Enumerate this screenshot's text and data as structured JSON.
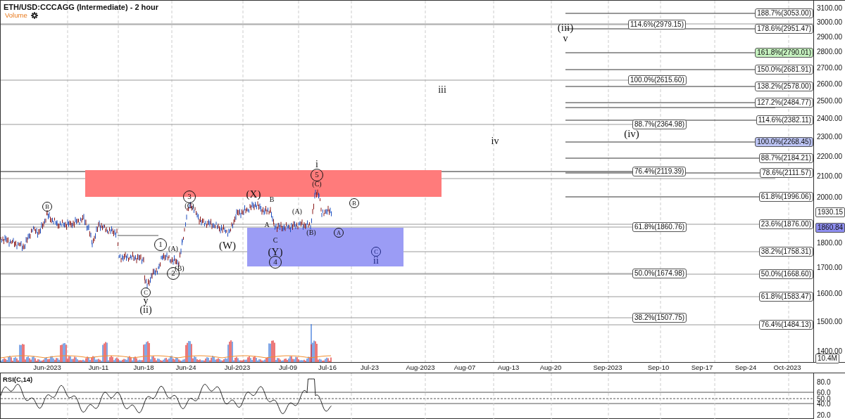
{
  "chart": {
    "title": "ETH/USD:CCCAGG (Intermediate) - 2 hour",
    "indicator": "Volume"
  },
  "price_axis": {
    "ticks": [
      "3100.00",
      "3000.00",
      "2900.00",
      "2800.00",
      "2700.00",
      "2600.00",
      "2500.00",
      "2400.00",
      "2300.00",
      "2200.00",
      "2100.00",
      "2000.00",
      "1800.00",
      "1700.00",
      "1600.00",
      "1500.00",
      "1400.00"
    ],
    "price_tags": [
      {
        "label": "1930.15",
        "color": "#ffffff"
      },
      {
        "label": "1860.84",
        "color": "#8e8ef0"
      }
    ],
    "volume_tag": "10.4M"
  },
  "time_axis": {
    "labels": [
      "Jun-2023",
      "Jun-11",
      "Jun-18",
      "Jun-24",
      "Jul-2023",
      "Jul-09",
      "Jul-16",
      "Jul-23",
      "Aug-2023",
      "Aug-07",
      "Aug-13",
      "Aug-20",
      "Sep-2023",
      "Sep-10",
      "Sep-17",
      "Sep-24",
      "Oct-2023"
    ]
  },
  "fib_levels_right": [
    {
      "label": "188.7%(3053.00)",
      "color": "#ffffff"
    },
    {
      "label": "178.6%(2951.47)",
      "color": "#ffffff"
    },
    {
      "label": "161.8%(2790.01)",
      "color": "#c6f2c0"
    },
    {
      "label": "150.0%(2681.91)",
      "color": "#ffffff"
    },
    {
      "label": "138.2%(2578.00)",
      "color": "#ffffff"
    },
    {
      "label": "127.2%(2484.77)",
      "color": "#ffffff"
    },
    {
      "label": "114.6%(2382.11)",
      "color": "#ffffff"
    },
    {
      "label": "100.0%(2268.45)",
      "color": "#bcc4f4"
    },
    {
      "label": "88.7%(2184.21)",
      "color": "#ffffff"
    },
    {
      "label": "78.6%(2111.57)",
      "color": "#ffffff"
    },
    {
      "label": "61.8%(1996.06)",
      "color": "#ffffff"
    },
    {
      "label": "23.6%(1876.00)",
      "color": "#ffffff"
    },
    {
      "label": "38.2%(1758.31)",
      "color": "#ffffff"
    },
    {
      "label": "50.0%(1668.60)",
      "color": "#ffffff"
    },
    {
      "label": "61.8%(1583.47)",
      "color": "#ffffff"
    },
    {
      "label": "76.4%(1484.13)",
      "color": "#ffffff"
    }
  ],
  "fib_levels_center": [
    {
      "label": "114.6%(2979.15)"
    },
    {
      "label": "100.0%(2615.60)"
    },
    {
      "label": "88.7%(2364.98)"
    },
    {
      "label": "76.4%(2119.39)"
    },
    {
      "label": "61.8%(1860.76)"
    },
    {
      "label": "50.0%(1674.98)"
    },
    {
      "label": "38.2%(1507.75)"
    }
  ],
  "wave_labels": [
    {
      "text": "B",
      "circled": true
    },
    {
      "text": "C",
      "circled": true
    },
    {
      "text": "y",
      "circled": false
    },
    {
      "text": "(ii)",
      "circled": false
    },
    {
      "text": "1",
      "circled": true
    },
    {
      "text": "(A)",
      "circled": false
    },
    {
      "text": "2",
      "circled": true
    },
    {
      "text": "(B)",
      "circled": false
    },
    {
      "text": "3",
      "circled": true
    },
    {
      "text": "(C)",
      "circled": false
    },
    {
      "text": "(W)",
      "circled": false
    },
    {
      "text": "(X)",
      "circled": false
    },
    {
      "text": "A",
      "circled": false
    },
    {
      "text": "B",
      "circled": false
    },
    {
      "text": "C",
      "circled": false
    },
    {
      "text": "(Y)",
      "circled": false
    },
    {
      "text": "4",
      "circled": true
    },
    {
      "text": "(A)",
      "circled": false
    },
    {
      "text": "(B)",
      "circled": false
    },
    {
      "text": "i",
      "circled": false
    },
    {
      "text": "5",
      "circled": true
    },
    {
      "text": "(C)",
      "circled": false
    },
    {
      "text": "A",
      "circled": true
    },
    {
      "text": "B",
      "circled": true
    },
    {
      "text": "C",
      "circled": true
    },
    {
      "text": "ii",
      "circled": false
    },
    {
      "text": "iii",
      "circled": false
    },
    {
      "text": "iv",
      "circled": false
    },
    {
      "text": "(iii)",
      "circled": false
    },
    {
      "text": "v",
      "circled": false
    },
    {
      "text": "(iv)",
      "circled": false
    }
  ],
  "rsi": {
    "title": "RSI(C,14)",
    "ticks": [
      "80.0",
      "60.0",
      "50.0",
      "40.0",
      "20.0"
    ]
  }
}
